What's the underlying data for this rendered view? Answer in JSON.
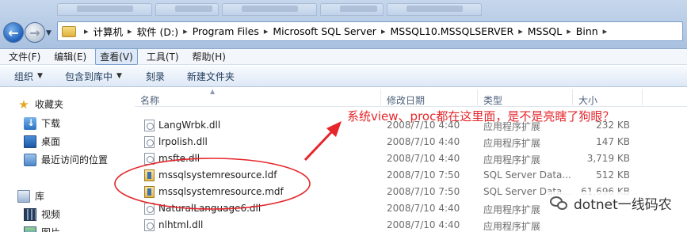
{
  "address_bar": {
    "crumbs": [
      "计算机",
      "软件 (D:)",
      "Program Files",
      "Microsoft SQL Server",
      "MSSQL10.MSSQLSERVER",
      "MSSQL",
      "Binn"
    ]
  },
  "menu": {
    "items": [
      "文件(F)",
      "编辑(E)",
      "查看(V)",
      "工具(T)",
      "帮助(H)"
    ]
  },
  "toolbar": {
    "organize": "组织",
    "include_in_library": "包含到库中",
    "burn": "刻录",
    "new_folder": "新建文件夹"
  },
  "sidebar": {
    "favorites": "收藏夹",
    "items": [
      "下载",
      "桌面",
      "最近访问的位置"
    ],
    "libraries": "库",
    "library_items": [
      "视频",
      "图片"
    ]
  },
  "columns": {
    "name": "名称",
    "date": "修改日期",
    "type": "类型",
    "size": "大小"
  },
  "files": [
    {
      "name": "LangWrbk.dll",
      "date": "2008/7/10 4:40",
      "type": "应用程序扩展",
      "size": "232 KB",
      "icon": "dll"
    },
    {
      "name": "lrpolish.dll",
      "date": "2008/7/10 4:40",
      "type": "应用程序扩展",
      "size": "147 KB",
      "icon": "dll"
    },
    {
      "name": "msfte.dll",
      "date": "2008/7/10 4:40",
      "type": "应用程序扩展",
      "size": "3,719 KB",
      "icon": "dll"
    },
    {
      "name": "mssqlsystemresource.ldf",
      "date": "2008/7/10 7:50",
      "type": "SQL Server Data...",
      "size": "512 KB",
      "icon": "db"
    },
    {
      "name": "mssqlsystemresource.mdf",
      "date": "2008/7/10 7:50",
      "type": "SQL Server Data...",
      "size": "61,696 KB",
      "icon": "db"
    },
    {
      "name": "NaturalLanguage6.dll",
      "date": "2008/7/10 4:40",
      "type": "应用程序扩展",
      "size": "",
      "icon": "dll"
    },
    {
      "name": "nlhtml.dll",
      "date": "2008/7/10 4:40",
      "type": "应用程序扩展",
      "size": "",
      "icon": "dll"
    }
  ],
  "annotation": {
    "text": "系统view、proc都在这里面，是不是亮瞎了狗眼？",
    "color": "#e5262b"
  },
  "watermark": {
    "text": "dotnet一线码农"
  }
}
